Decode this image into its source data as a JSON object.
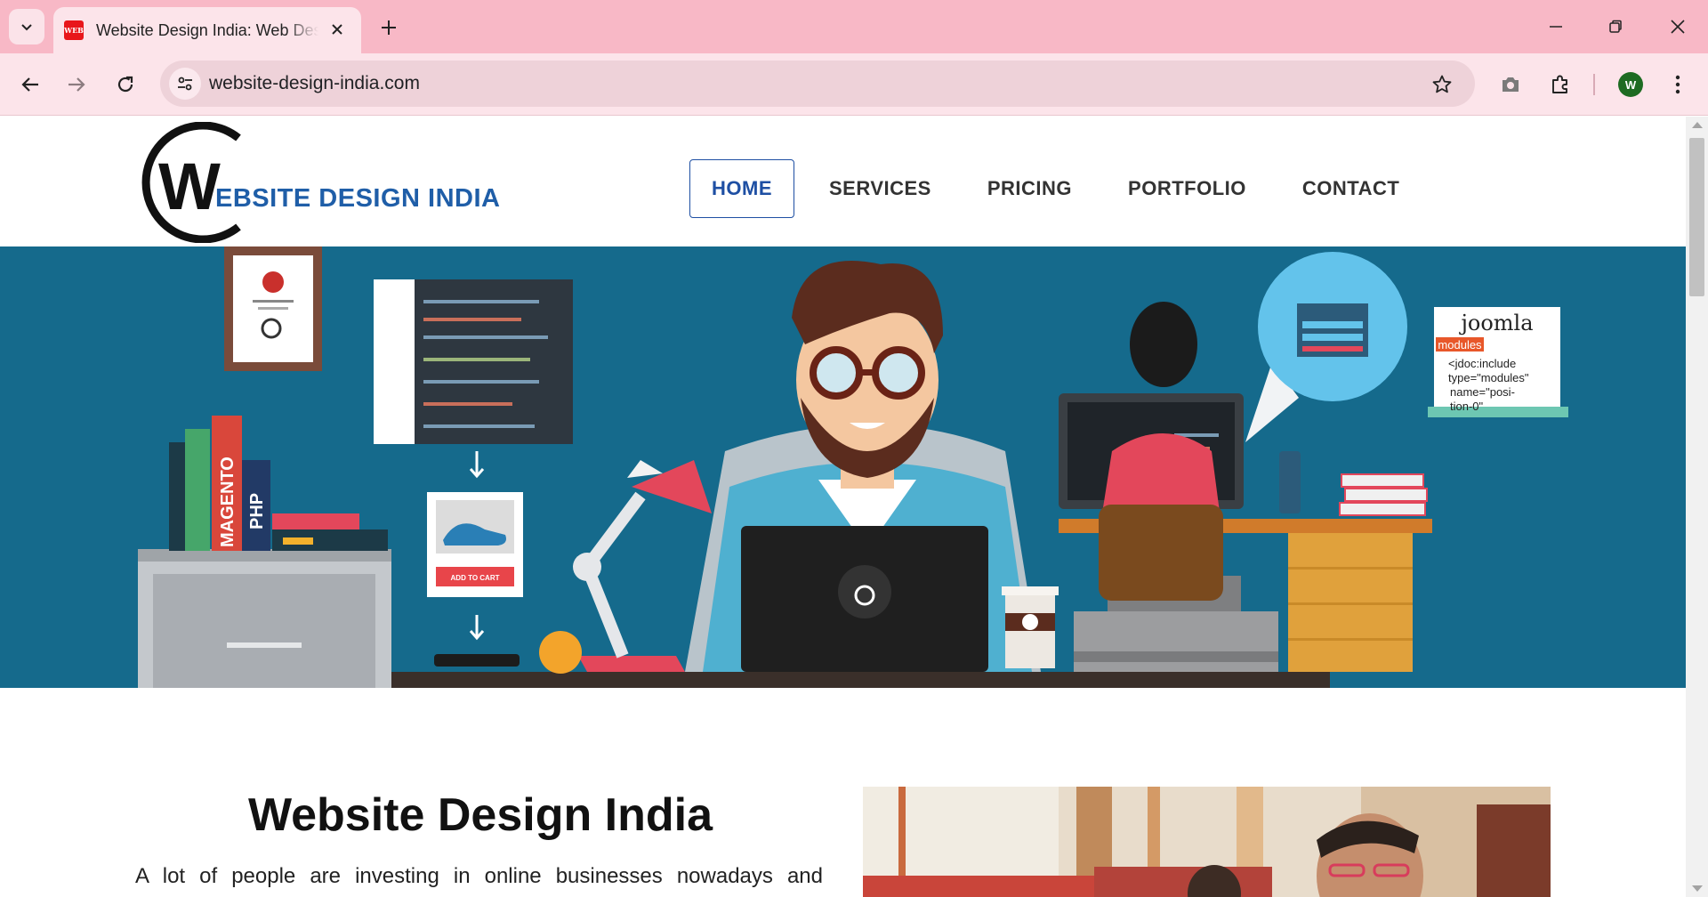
{
  "browser": {
    "tab_title": "Website Design India: Web Design",
    "favicon_text": "WEB",
    "url": "website-design-india.com",
    "profile_initial": "W"
  },
  "site": {
    "logo_letter": "W",
    "logo_text": "EBSITE DESIGN INDIA",
    "nav": [
      {
        "label": "HOME",
        "active": true
      },
      {
        "label": "SERVICES",
        "active": false
      },
      {
        "label": "PRICING",
        "active": false
      },
      {
        "label": "PORTFOLIO",
        "active": false
      },
      {
        "label": "CONTACT",
        "active": false
      }
    ],
    "hero": {
      "book_magento": "MAGENTO",
      "book_php": "PHP",
      "add_to_cart": "ADD TO CART",
      "note_title": "joomla",
      "note_tag": "modules",
      "note_code": [
        "<jdoc:include",
        "type=\"modules\"",
        "name=\"posi-",
        "tion-0\""
      ]
    },
    "intro": {
      "title": "Website Design India",
      "text": "A lot of people are investing in online businesses nowadays and"
    }
  },
  "colors": {
    "tab_strip": "#f8b8c6",
    "toolbar": "#fce4ea",
    "brand_blue": "#1f5ea8",
    "hero_bg": "#156a8c"
  }
}
